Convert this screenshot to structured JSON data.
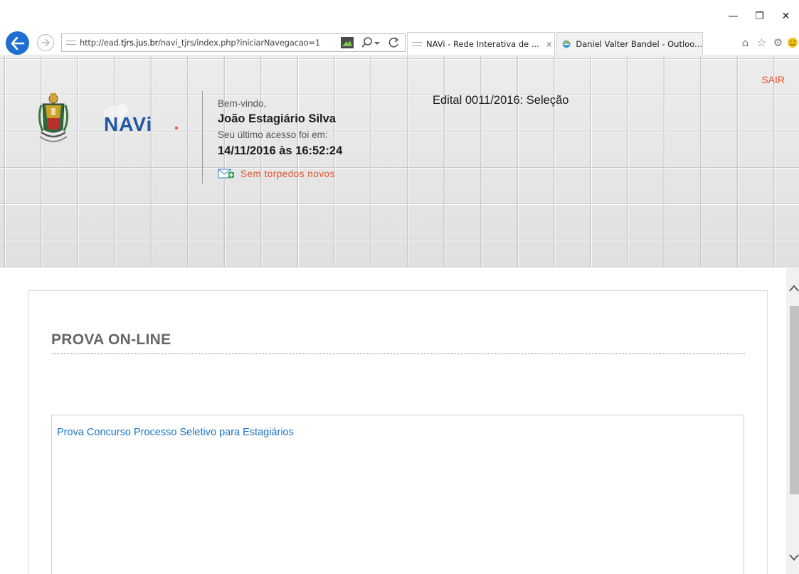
{
  "browser": {
    "url_prefix": "http://ead.",
    "url_domain": "tjrs.jus.br",
    "url_suffix": "/navi_tjrs/index.php?iniciarNavegacao=1",
    "tabs": [
      {
        "label": "NAVi - Rede Interativa de ...",
        "close": "×",
        "active": true
      },
      {
        "label": "Daniel Valter Bandel - Outloo...",
        "active": false
      }
    ]
  },
  "header": {
    "logo_text": "NAVi",
    "logout_label": "SAIR",
    "welcome_label": "Bem-vindo,",
    "user_name": "João Estagiário Silva",
    "last_access_label": "Seu último acesso foi em:",
    "last_access_value": "14/11/2016 às 16:52:24",
    "messages_label": "Sem torpedos novos",
    "edital": "Edital 0011/2016: Seleção"
  },
  "content": {
    "title": "PROVA ON-LINE",
    "items": [
      {
        "label": "Prova Concurso Processo Seletivo para Estagiários"
      }
    ]
  },
  "colors": {
    "accent_orange": "#e8502a",
    "link_blue": "#1a75c7",
    "ie_blue": "#1e6fd0"
  }
}
